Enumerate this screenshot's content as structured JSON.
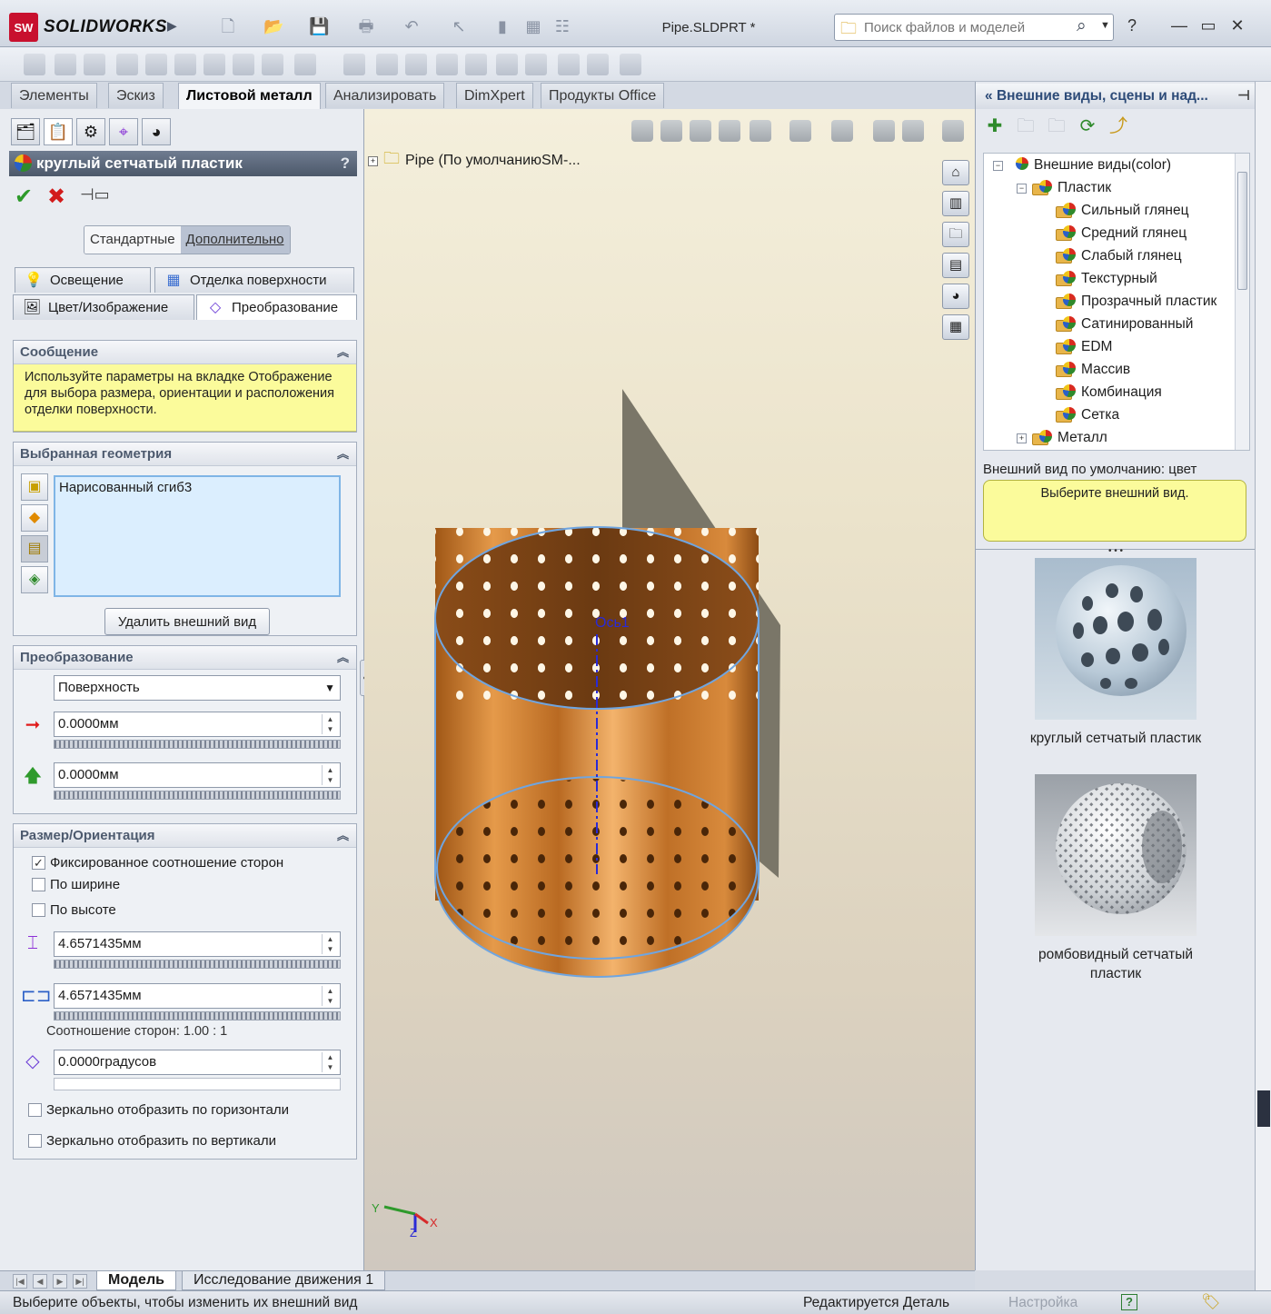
{
  "app": {
    "logo_badge": "SW",
    "logo_text": "SOLIDWORKS",
    "doc_title": "Pipe.SLDPRT *"
  },
  "search": {
    "placeholder": "Поиск файлов и моделей"
  },
  "cm_tabs": [
    "Элементы",
    "Эскиз",
    "Листовой металл",
    "Анализировать",
    "DimXpert",
    "Продукты Office"
  ],
  "cm_active_tab": "Листовой металл",
  "pm": {
    "title": "круглый сетчатый пластик",
    "help": "?",
    "mode_standard": "Стандартные",
    "mode_advanced": "Дополнительно",
    "subtabs": [
      "Освещение",
      "Отделка поверхности",
      "Цвет/Изображение",
      "Преобразование"
    ],
    "message": {
      "header": "Сообщение",
      "text": "Используйте параметры на вкладке Отображение для выбора размера, ориентации и расположения отделки поверхности."
    },
    "geometry": {
      "header": "Выбранная геометрия",
      "items": [
        "Нарисованный сгиб3"
      ],
      "remove_label": "Удалить внешний вид"
    },
    "transform": {
      "header": "Преобразование",
      "mapping": "Поверхность",
      "horizontal": "0.0000мм",
      "vertical": "0.0000мм"
    },
    "size": {
      "header": "Размер/Ориентация",
      "fixed_aspect_label": "Фиксированное соотношение сторон",
      "fixed_aspect_checked": true,
      "by_width_label": "По ширине",
      "by_height_label": "По высоте",
      "width": "4.6571435мм",
      "height": "4.6571435мм",
      "aspect_text": "Соотношение сторон: 1.00 : 1",
      "rotation": "0.0000градусов",
      "mirror_h_label": "Зеркально отобразить по горизонтали",
      "mirror_v_label": "Зеркально отобразить по вертикали"
    }
  },
  "viewport": {
    "tree_label": "Pipe  (По умолчаниюSM-...",
    "axis_label": "Ось1",
    "triad": {
      "x": "X",
      "y": "Y",
      "z": "Z"
    }
  },
  "task_pane": {
    "title": "Внешние виды, сцены и над...",
    "tree": [
      {
        "label": "Внешние виды(color)",
        "level": 0,
        "box": "−"
      },
      {
        "label": "Пластик",
        "level": 1,
        "box": "−"
      },
      {
        "label": "Сильный глянец",
        "level": 2
      },
      {
        "label": "Средний глянец",
        "level": 2
      },
      {
        "label": "Слабый глянец",
        "level": 2
      },
      {
        "label": "Текстурный",
        "level": 2
      },
      {
        "label": "Прозрачный пластик",
        "level": 2
      },
      {
        "label": "Сатинированный",
        "level": 2
      },
      {
        "label": "EDM",
        "level": 2
      },
      {
        "label": "Массив",
        "level": 2
      },
      {
        "label": "Комбинация",
        "level": 2
      },
      {
        "label": "Сетка",
        "level": 2
      },
      {
        "label": "Металл",
        "level": 1,
        "box": "+"
      }
    ],
    "default_label": "Внешний вид по умолчанию: цвет",
    "default_prompt": "Выберите внешний вид.",
    "thumbnails": [
      "круглый сетчатый пластик",
      "ромбовидный сетчатый пластик"
    ]
  },
  "bottom_tabs": [
    "Модель",
    "Исследование движения 1"
  ],
  "status": {
    "message": "Выберите объекты, чтобы изменить их внешний вид",
    "editing": "Редактируется Деталь",
    "customize": "Настройка",
    "help": "?"
  },
  "colors": {
    "accent": "#2d4b78",
    "copper": "#c8772b",
    "message_bg": "#fbfb9b"
  }
}
